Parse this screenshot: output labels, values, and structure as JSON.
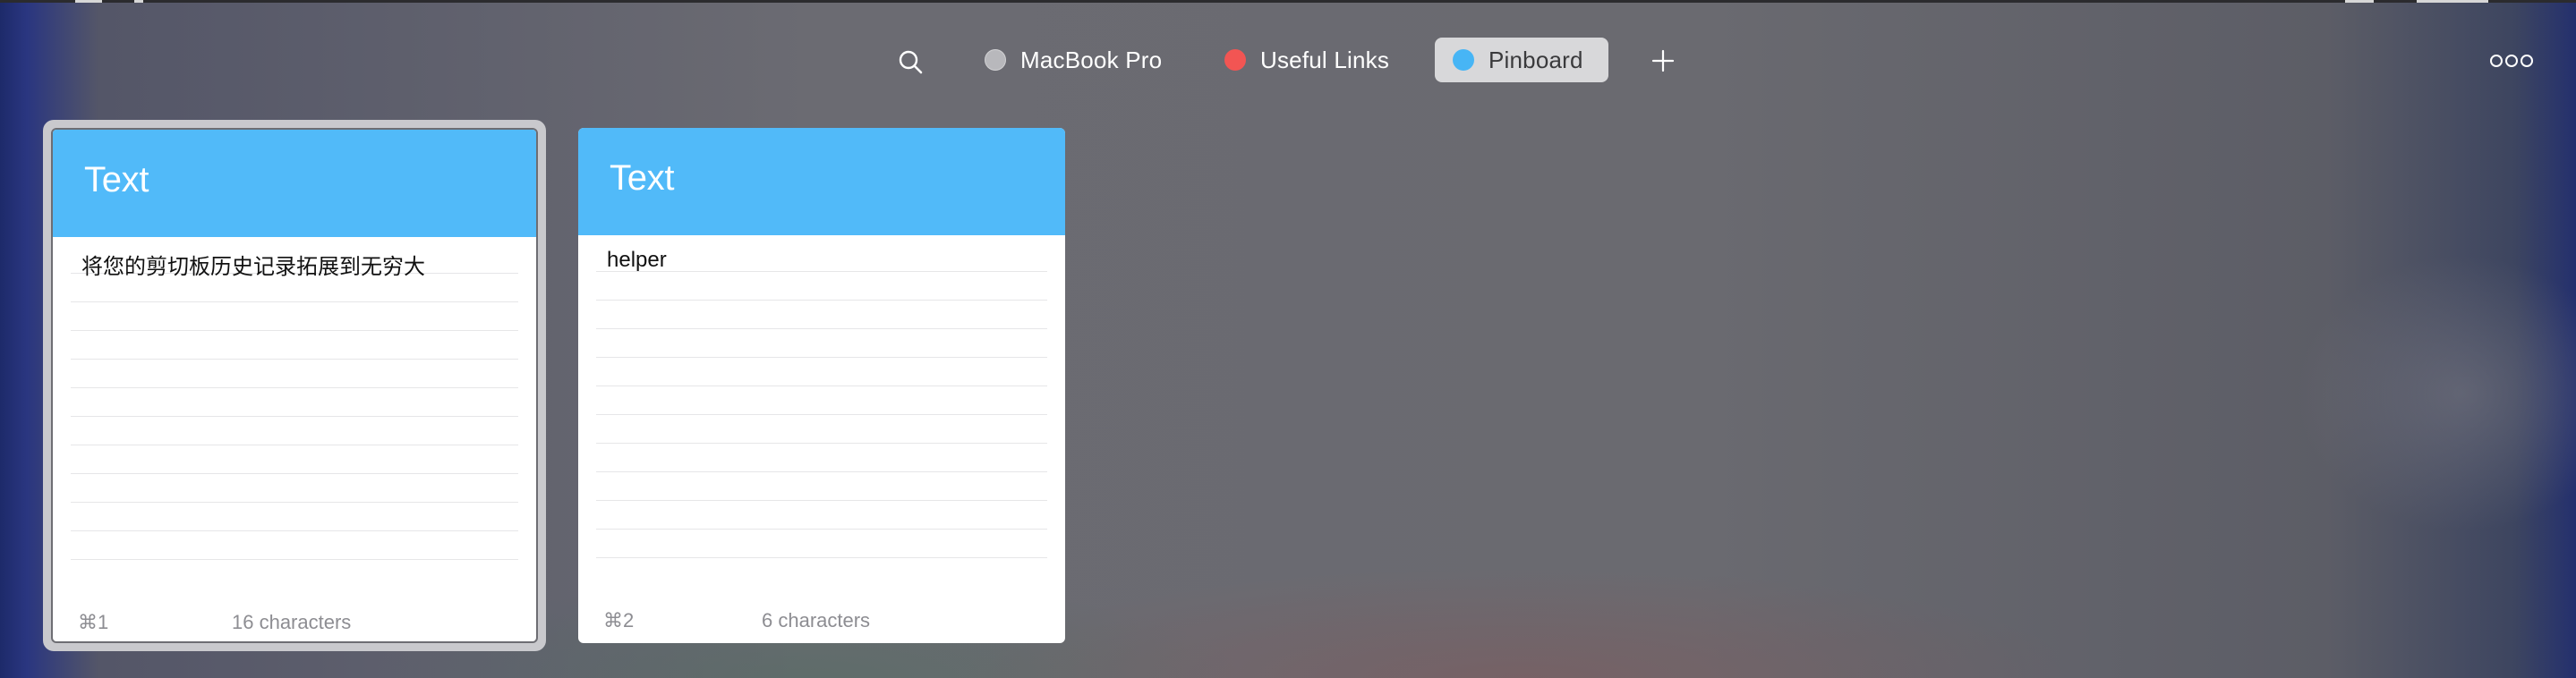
{
  "toolbar": {
    "search_icon": "search-icon",
    "tabs": [
      {
        "label": "MacBook Pro",
        "color": "#b8b8bc",
        "active": false
      },
      {
        "label": "Useful Links",
        "color": "#f25553",
        "active": false
      },
      {
        "label": "Pinboard",
        "color": "#47b5f5",
        "active": true
      }
    ],
    "add_icon": "plus-icon",
    "more_icon": "more-options-icon"
  },
  "cards": [
    {
      "type": "Text",
      "content": "将您的剪切板历史记录拓展到无穷大",
      "shortcut": "⌘1",
      "char_count": "16 characters",
      "selected": true,
      "header_color": "#51baf9"
    },
    {
      "type": "Text",
      "content": "helper",
      "shortcut": "⌘2",
      "char_count": "6 characters",
      "selected": false,
      "header_color": "#51baf9"
    }
  ]
}
